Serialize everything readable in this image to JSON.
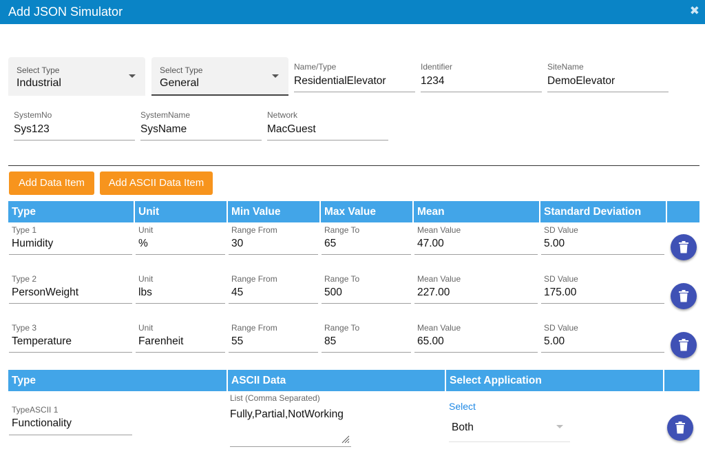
{
  "window": {
    "title": "Add JSON Simulator",
    "close_glyph": "✖"
  },
  "selects": [
    {
      "label": "Select Type",
      "value": "Industrial"
    },
    {
      "label": "Select Type",
      "value": "General"
    }
  ],
  "fields_row1": [
    {
      "label": "Name/Type",
      "value": "ResidentialElevator"
    },
    {
      "label": "Identifier",
      "value": "1234"
    },
    {
      "label": "SiteName",
      "value": "DemoElevator"
    }
  ],
  "fields_row2": [
    {
      "label": "SystemNo",
      "value": "Sys123"
    },
    {
      "label": "SystemName",
      "value": "SysName"
    },
    {
      "label": "Network",
      "value": "MacGuest"
    }
  ],
  "buttons": {
    "add_data_item": "Add Data Item",
    "add_ascii_item": "Add ASCII Data Item"
  },
  "data_table": {
    "headers": [
      "Type",
      "Unit",
      "Min Value",
      "Max Value",
      "Mean",
      "Standard Deviation"
    ],
    "rows": [
      {
        "type_label": "Type 1",
        "type": "Humidity",
        "unit_label": "Unit",
        "unit": "%",
        "min_label": "Range From",
        "min": "30",
        "max_label": "Range To",
        "max": "65",
        "mean_label": "Mean Value",
        "mean": "47.00",
        "sd_label": "SD Value",
        "sd": "5.00"
      },
      {
        "type_label": "Type 2",
        "type": "PersonWeight",
        "unit_label": "Unit",
        "unit": "lbs",
        "min_label": "Range From",
        "min": "45",
        "max_label": "Range To",
        "max": "500",
        "mean_label": "Mean Value",
        "mean": "227.00",
        "sd_label": "SD Value",
        "sd": "175.00"
      },
      {
        "type_label": "Type 3",
        "type": "Temperature",
        "unit_label": "Unit",
        "unit": "Farenheit",
        "min_label": "Range From",
        "min": "55",
        "max_label": "Range To",
        "max": "85",
        "mean_label": "Mean Value",
        "mean": "65.00",
        "sd_label": "SD Value",
        "sd": "5.00"
      }
    ]
  },
  "ascii_table": {
    "headers": [
      "Type",
      "ASCII Data",
      "Select Application"
    ],
    "rows": [
      {
        "type_label": "TypeASCII 1",
        "type": "Functionality",
        "data_label": "List (Comma Separated)",
        "data": "Fully,Partial,NotWorking",
        "app_label": "Select",
        "app_value": "Both"
      }
    ]
  },
  "colors": {
    "title_bar": "#0a84c6",
    "table_header": "#42a5e8",
    "button": "#f7941d",
    "delete_button": "#3f51b5",
    "link": "#1e88e5"
  },
  "icons": {
    "delete": "trash-icon",
    "close": "close-icon",
    "dropdown": "chevron-down-icon"
  }
}
